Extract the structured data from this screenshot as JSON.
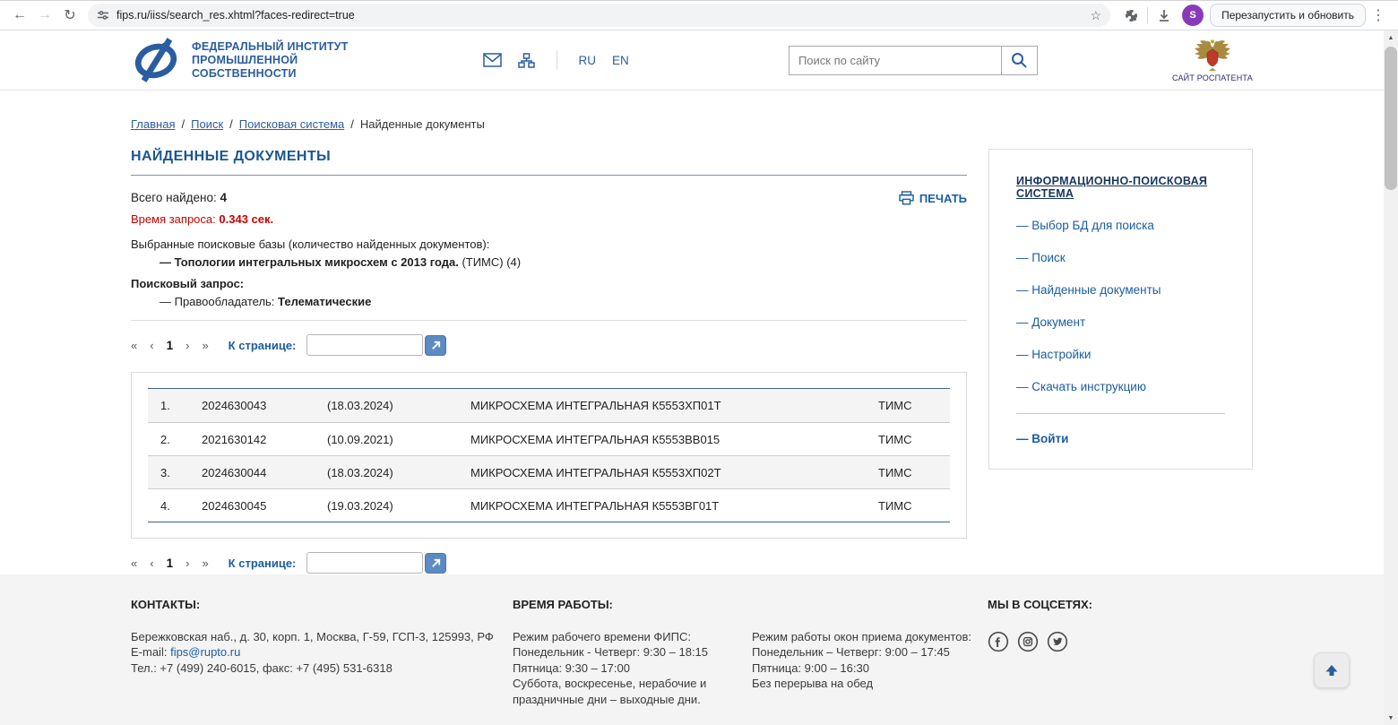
{
  "icons": {
    "back": "←",
    "forward": "→",
    "reload": "↻",
    "star": "☆",
    "menu": "⋮",
    "scroll_up": "▲",
    "scroll_down": "▼"
  },
  "browser": {
    "url": "fips.ru/iiss/search_res.xhtml?faces-redirect=true",
    "relaunch": "Перезапустить и обновить",
    "avatar": "S"
  },
  "header": {
    "line1": "ФЕДЕРАЛЬНЫЙ ИНСТИТУТ",
    "line2": "ПРОМЫШЛЕННОЙ",
    "line3": "СОБСТВЕННОСТИ",
    "lang_ru": "RU",
    "lang_en": "EN",
    "search_placeholder": "Поиск по сайту",
    "rospatent_caption": "САЙТ РОСПАТЕНТА"
  },
  "breadcrumbs": {
    "separator": "/",
    "items": [
      {
        "label": "Главная"
      },
      {
        "label": "Поиск"
      },
      {
        "label": "Поисковая система"
      },
      {
        "label": "Найденные документы"
      }
    ]
  },
  "page": {
    "title": "НАЙДЕННЫЕ ДОКУМЕНТЫ",
    "print": "ПЕЧАТЬ",
    "found_label": "Всего найдено:",
    "found_value": "4",
    "time_label": "Время запроса:",
    "time_value": "0.343 сек.",
    "bases_label": "Выбранные поисковые базы (количество найденных документов):",
    "bases_bold": "— Топологии интегральных микросхем с 2013 года.",
    "bases_rest": "(ТИМС) (4)",
    "query_label": "Поисковый запрос:",
    "query_prefix": "— Правообладатель:",
    "query_value": "Телематические"
  },
  "pagination": {
    "first": "«",
    "prev": "‹",
    "current": "1",
    "next": "›",
    "last": "»",
    "goto_label": "К странице:"
  },
  "results": [
    {
      "num": "1.",
      "reg": "2024630043",
      "date": "(18.03.2024)",
      "name": "МИКРОСХЕМА ИНТЕГРАЛЬНАЯ К5553ХП01Т",
      "db": "ТИМС"
    },
    {
      "num": "2.",
      "reg": "2021630142",
      "date": "(10.09.2021)",
      "name": "МИКРОСХЕМА ИНТЕГРАЛЬНАЯ К5553ВВ015",
      "db": "ТИМС"
    },
    {
      "num": "3.",
      "reg": "2024630044",
      "date": "(18.03.2024)",
      "name": "МИКРОСХЕМА ИНТЕГРАЛЬНАЯ К5553ХП02Т",
      "db": "ТИМС"
    },
    {
      "num": "4.",
      "reg": "2024630045",
      "date": "(19.03.2024)",
      "name": "МИКРОСХЕМА ИНТЕГРАЛЬНАЯ К5553ВГ01Т",
      "db": "ТИМС"
    }
  ],
  "sidebar": {
    "title": "ИНФОРМАЦИОННО-ПОИСКОВАЯ СИСТЕМА",
    "items": [
      "— Выбор БД для поиска",
      "— Поиск",
      "— Найденные документы",
      "— Документ",
      "— Настройки",
      "— Скачать инструкцию"
    ],
    "login": "— Войти"
  },
  "footer": {
    "contacts_title": "КОНТАКТЫ:",
    "address": "Бережковская наб., д. 30, корп. 1, Москва, Г-59, ГСП-3, 125993, РФ",
    "email_label": "E-mail:",
    "email": "fips@rupto.ru",
    "phone": "Тел.: +7 (499) 240-6015, факс: +7 (495) 531-6318",
    "hours_title": "ВРЕМЯ РАБОТЫ:",
    "h1": [
      "Режим рабочего времени ФИПС:",
      "Понедельник - Четверг: 9:30 – 18:15",
      "Пятница: 9:30 – 17:00",
      "Суббота, воскресенье, нерабочие и",
      "праздничные дни – выходные дни."
    ],
    "h2": [
      "Режим работы окон приема документов:",
      "Понедельник – Четверг: 9:00 – 17:45",
      "Пятница: 9:00 – 16:30",
      "Без перерыва на обед"
    ],
    "social_title": "МЫ В СОЦСЕТЯХ:"
  }
}
